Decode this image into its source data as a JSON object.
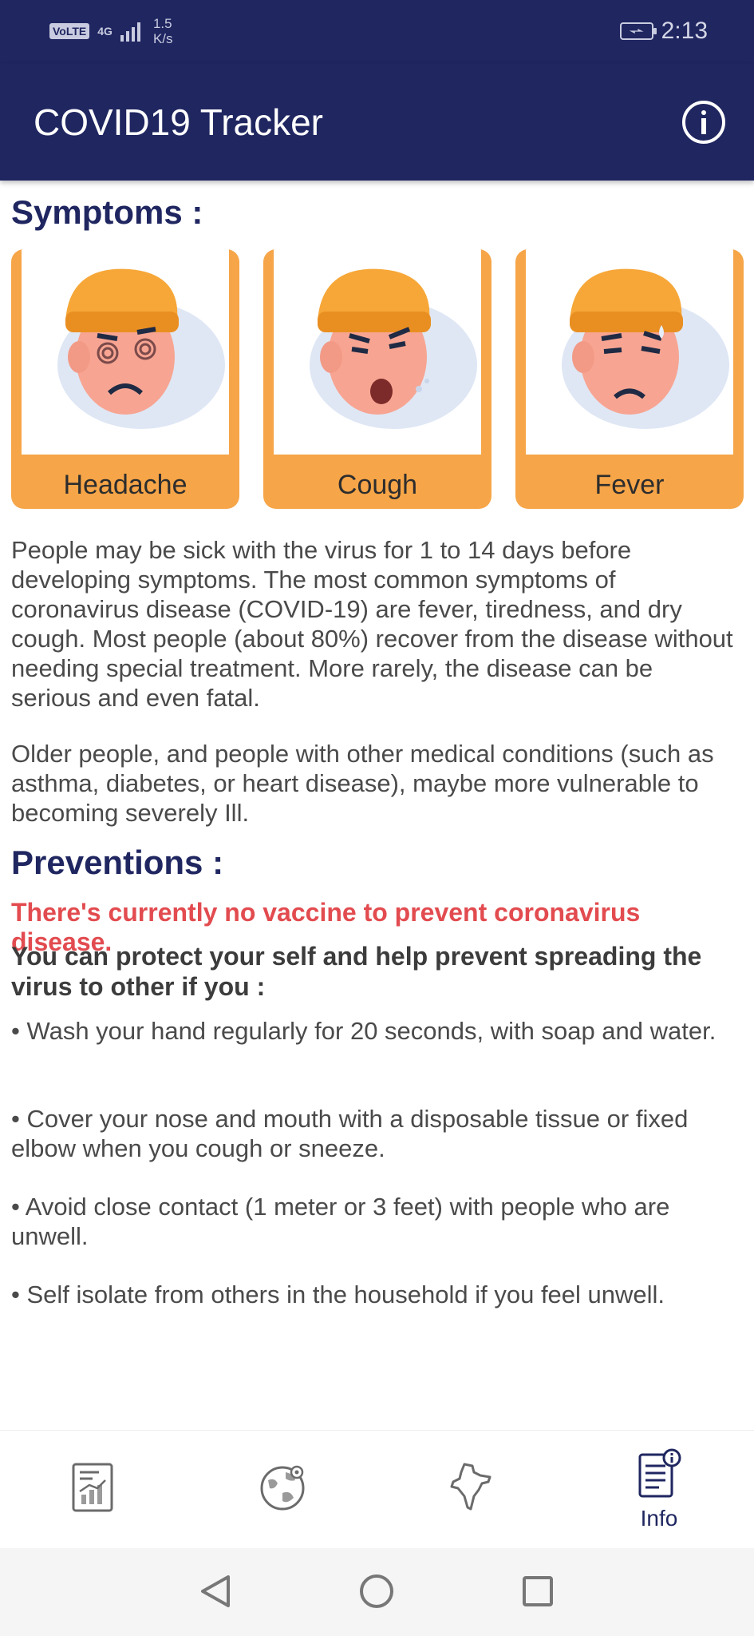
{
  "status_bar": {
    "volte": "VoLTE",
    "network": "4G",
    "speed_value": "1.5",
    "speed_unit": "K/s",
    "time": "2:13"
  },
  "app_bar": {
    "title": "COVID19 Tracker",
    "info_icon": "info-circle-icon"
  },
  "symptoms": {
    "heading": "Symptoms :",
    "cards": [
      {
        "label": "Headache",
        "icon": "headache-face-illustration"
      },
      {
        "label": "Cough",
        "icon": "cough-face-illustration"
      },
      {
        "label": "Fever",
        "icon": "fever-face-illustration"
      }
    ],
    "paragraph_1": "People may be sick with the virus for 1 to 14 days before developing symptoms. The most common symptoms of coronavirus disease (COVID-19) are fever, tiredness, and dry cough. Most people (about 80%) recover from the disease without needing special treatment. More rarely, the disease can be serious and even fatal.",
    "paragraph_2": "Older people, and people with other medical conditions (such as asthma, diabetes, or heart disease), maybe more vulnerable to becoming severely Ill."
  },
  "preventions": {
    "heading": "Preventions :",
    "warning": "There's currently no vaccine to prevent coronavirus disease.",
    "intro": "You can protect your self and help prevent spreading the virus to other if you :",
    "bullets": [
      "• Wash your hand regularly for 20 seconds, with soap and water.",
      " • Cover your nose and mouth with a disposable tissue or fixed elbow when you cough or sneeze.",
      " • Avoid close contact (1 meter or 3 feet) with people who are unwell.",
      " • Self isolate from others in the household if you feel unwell."
    ]
  },
  "bottom_nav": {
    "items": [
      {
        "icon": "stats-report-icon",
        "label": ""
      },
      {
        "icon": "globe-icon",
        "label": ""
      },
      {
        "icon": "india-map-icon",
        "label": ""
      },
      {
        "icon": "info-document-icon",
        "label": "Info"
      }
    ]
  },
  "colors": {
    "primary": "#1f2660",
    "card": "#f6a548",
    "warning": "#e24b4f"
  }
}
